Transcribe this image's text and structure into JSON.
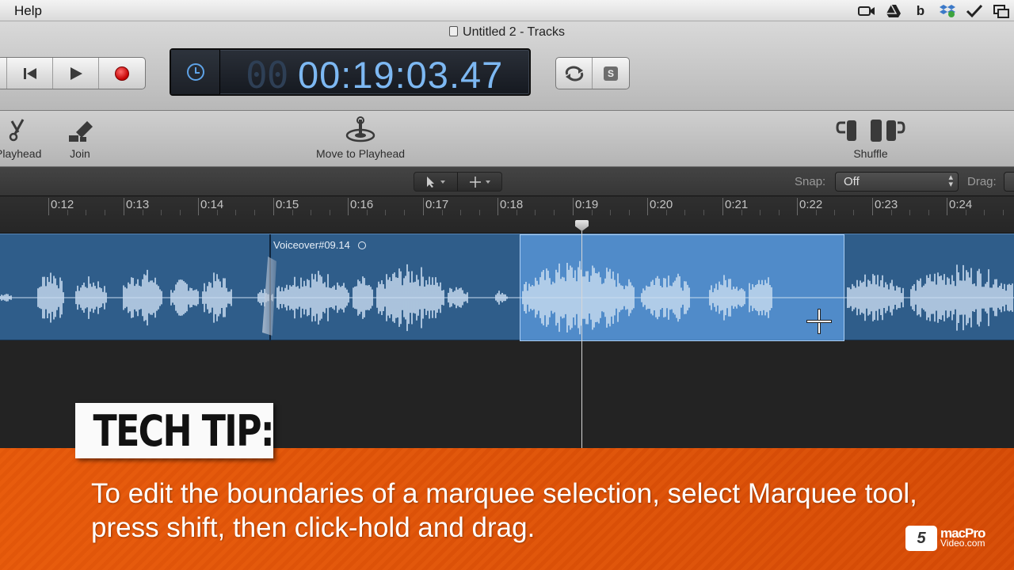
{
  "menubar": {
    "help": "Help",
    "status_icons": [
      "video-icon",
      "drive-icon",
      "b-icon",
      "dropbox-icon",
      "checkmark-icon",
      "display-icon"
    ]
  },
  "window": {
    "title": "Untitled 2 - Tracks"
  },
  "transport": {
    "buttons": [
      "rewind",
      "play",
      "record"
    ]
  },
  "lcd": {
    "dim_prefix": "00",
    "time": "00:19:03.47"
  },
  "toolbar": {
    "playhead_label": "Playhead",
    "join_label": "Join",
    "move_to_playhead_label": "Move to Playhead",
    "shuffle_label": "Shuffle"
  },
  "editbar": {
    "snap_label": "Snap:",
    "snap_value": "Off",
    "drag_label": "Drag:"
  },
  "ruler": {
    "ticks": [
      "0:12",
      "0:13",
      "0:14",
      "0:15",
      "0:16",
      "0:17",
      "0:18",
      "0:19",
      "0:20",
      "0:21",
      "0:22",
      "0:23",
      "0:24"
    ]
  },
  "region": {
    "name": "Voiceover#09.14",
    "color": "#2f5d8a",
    "selection_color": "#5c9bde"
  },
  "tip": {
    "title": "TECH TIP:",
    "text": "To edit the boundaries of a marquee selection, select Marquee tool, press shift, then click-hold and drag.",
    "accent": "#e0560b"
  },
  "logo": {
    "line1": "macPro",
    "line2": "Video.com"
  }
}
